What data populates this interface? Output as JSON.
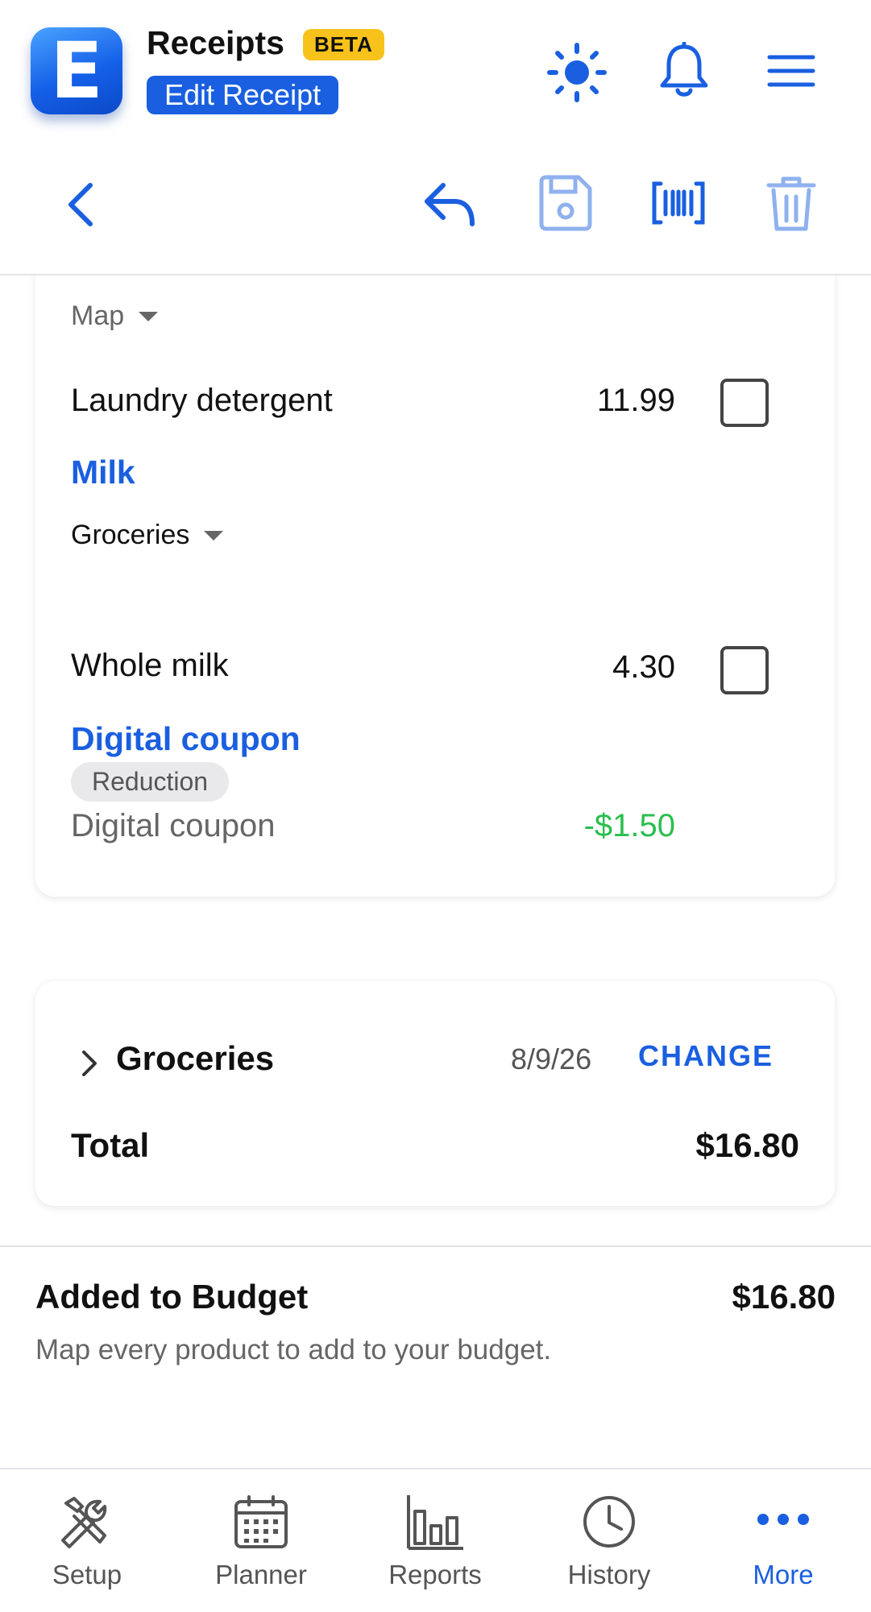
{
  "header": {
    "logo_letter": "E",
    "app_title": "Receipts",
    "beta_badge": "BETA",
    "page_badge": "Edit Receipt",
    "icons": [
      "sun-icon",
      "bell-icon",
      "menu-icon"
    ]
  },
  "toolbar": {
    "icons": [
      "back-chevron-icon",
      "reply-icon",
      "save-icon",
      "barcode-icon",
      "trash-icon"
    ]
  },
  "items_card": {
    "sections": [
      {
        "category_select": "Map",
        "items": [
          {
            "name": "Laundry detergent",
            "price": "11.99",
            "checked": false
          }
        ]
      },
      {
        "title": "Milk",
        "category_select": "Groceries",
        "items": [
          {
            "name": "Whole milk",
            "price": "4.30",
            "checked": false
          }
        ]
      },
      {
        "title": "Digital coupon",
        "tag": "Reduction",
        "name": "Digital coupon",
        "amount": "-$1.50"
      }
    ]
  },
  "summary_card": {
    "category": "Groceries",
    "date": "8/9/26",
    "change_label": "CHANGE",
    "total_label": "Total",
    "total_value": "$16.80"
  },
  "budget": {
    "title": "Added to Budget",
    "value": "$16.80",
    "hint": "Map every product to add to your budget."
  },
  "tabs": [
    {
      "label": "Setup",
      "icon": "tools-icon",
      "active": false
    },
    {
      "label": "Planner",
      "icon": "calendar-icon",
      "active": false
    },
    {
      "label": "Reports",
      "icon": "bar-chart-icon",
      "active": false
    },
    {
      "label": "History",
      "icon": "clock-icon",
      "active": false
    },
    {
      "label": "More",
      "icon": "more-dots-icon",
      "active": true
    }
  ],
  "colors": {
    "accent": "#1a5fe0",
    "beta": "#f7c21b",
    "positive": "#2bbf4f",
    "disabled_icon": "#8fb1ee"
  }
}
